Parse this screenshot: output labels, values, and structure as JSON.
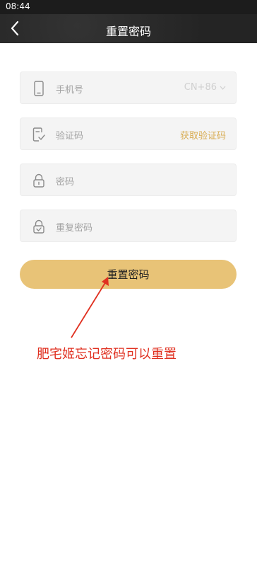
{
  "status_bar": {
    "time": "08:44"
  },
  "nav": {
    "title": "重置密码"
  },
  "form": {
    "phone": {
      "placeholder": "手机号",
      "country_code": "CN+86"
    },
    "code": {
      "placeholder": "验证码",
      "get_code_label": "获取验证码"
    },
    "password": {
      "placeholder": "密码"
    },
    "confirm_password": {
      "placeholder": "重复密码"
    },
    "submit_label": "重置密码"
  },
  "annotation": {
    "text": "肥宅姬忘记密码可以重置",
    "color": "#e03020"
  },
  "colors": {
    "accent": "#e8c377",
    "link": "#d8ac52"
  },
  "icons": {
    "back": "chevron-left-icon",
    "phone": "phone-icon",
    "code": "verify-code-icon",
    "password": "lock-icon",
    "confirm_password": "lock-check-icon"
  }
}
